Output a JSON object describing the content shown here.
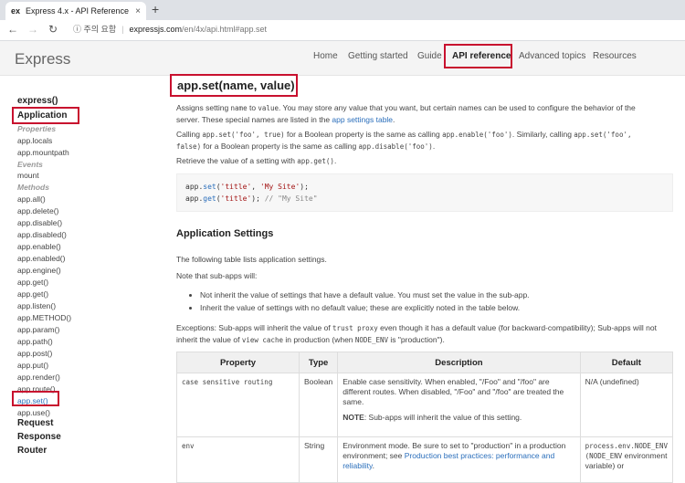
{
  "browser": {
    "tab_favicon": "ex",
    "tab_title": "Express 4.x - API Reference",
    "tab_close": "×",
    "new_tab": "+",
    "back": "←",
    "forward": "→",
    "reload": "↻",
    "security": "ⓘ 주의 요함",
    "separator": "|",
    "url_host": "expressjs.com",
    "url_path": "/en/4x/api.html#app.set"
  },
  "site": {
    "logo": "Express",
    "nav": [
      "Home",
      "Getting started",
      "Guide",
      "API reference",
      "Advanced topics",
      "Resources"
    ]
  },
  "sidebar": {
    "express": "express()",
    "application": "Application",
    "properties_label": "Properties",
    "properties": [
      "app.locals",
      "app.mountpath"
    ],
    "events_label": "Events",
    "events": [
      "mount"
    ],
    "methods_label": "Methods",
    "methods": [
      "app.all()",
      "app.delete()",
      "app.disable()",
      "app.disabled()",
      "app.enable()",
      "app.enabled()",
      "app.engine()",
      "app.get()",
      "app.get()",
      "app.listen()",
      "app.METHOD()",
      "app.param()",
      "app.path()",
      "app.post()",
      "app.put()",
      "app.render()",
      "app.route()",
      "app.set()",
      "app.use()"
    ],
    "request": "Request",
    "response": "Response",
    "router": "Router"
  },
  "content": {
    "heading": "app.set(name, value)",
    "p1_a": "Assigns setting ",
    "p1_name": "name",
    "p1_b": " to ",
    "p1_value": "value",
    "p1_c": ". You may store any value that you want, but certain names can be used to configure the behavior of the server. These special names are listed in the ",
    "p1_link": "app settings table",
    "p1_d": ".",
    "p2_a": "Calling ",
    "p2_code1": "app.set('foo', true)",
    "p2_b": " for a Boolean property is the same as calling ",
    "p2_code2": "app.enable('foo')",
    "p2_c": ". Similarly, calling ",
    "p2_code3": "app.set('foo', false)",
    "p2_d": " for a Boolean property is the same as calling ",
    "p2_code4": "app.disable('foo')",
    "p2_e": ".",
    "p3_a": "Retrieve the value of a setting with ",
    "p3_code": "app.get()",
    "p3_b": ".",
    "code_line1": [
      "app.",
      "set",
      "(",
      "'title'",
      ", ",
      "'My Site'",
      ");"
    ],
    "code_line2": [
      "app.",
      "get",
      "(",
      "'title'",
      "); ",
      "// \"My Site\""
    ],
    "h2": "Application Settings",
    "p4": "The following table lists application settings.",
    "p5": "Note that sub-apps will:",
    "bullets": [
      "Not inherit the value of settings that have a default value. You must set the value in the sub-app.",
      "Inherit the value of settings with no default value; these are explicitly noted in the table below."
    ],
    "p6_a": "Exceptions: Sub-apps will inherit the value of ",
    "p6_code1": "trust proxy",
    "p6_b": " even though it has a default value (for backward-compatibility); Sub-apps will not inherit the value of ",
    "p6_code2": "view cache",
    "p6_c": " in production (when ",
    "p6_code3": "NODE_ENV",
    "p6_d": " is \"production\")."
  },
  "table": {
    "headers": [
      "Property",
      "Type",
      "Description",
      "Default"
    ],
    "rows": [
      {
        "property": "case sensitive routing",
        "type": "Boolean",
        "description": "Enable case sensitivity. When enabled, \"/Foo\" and \"/foo\" are different routes. When disabled, \"/Foo\" and \"/foo\" are treated the same.",
        "note_label": "NOTE",
        "note_text": ": Sub-apps will inherit the value of this setting.",
        "default": "N/A (undefined)"
      },
      {
        "property": "env",
        "type": "String",
        "description_a": "Environment mode. Be sure to set to \"production\" in a production environment; see ",
        "description_link": "Production best practices: performance and reliability",
        "description_b": ".",
        "default_code": "process.env.NODE_ENV",
        "default_code2": "(NODE_ENV",
        "default_a": " environment",
        "default_b": "variable) or"
      }
    ]
  }
}
